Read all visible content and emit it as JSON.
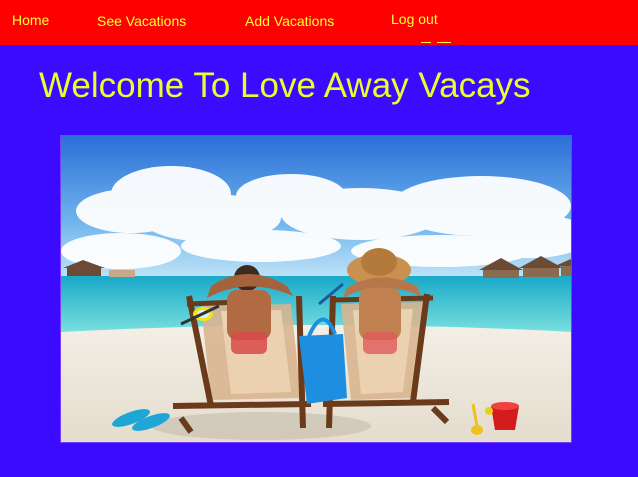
{
  "nav": {
    "home": "Home",
    "see_vacations": "See Vacations",
    "add_vacations": "Add Vacations",
    "log_out": "Log out"
  },
  "page": {
    "title": "Welcome To Love Away Vacays"
  },
  "hero_image": {
    "alt": "Couple relaxing on beach chairs by the sea"
  },
  "colors": {
    "navbar": "#ff0000",
    "background": "#3a0bff",
    "link": "#ffff33",
    "title": "#e8ff2e"
  }
}
